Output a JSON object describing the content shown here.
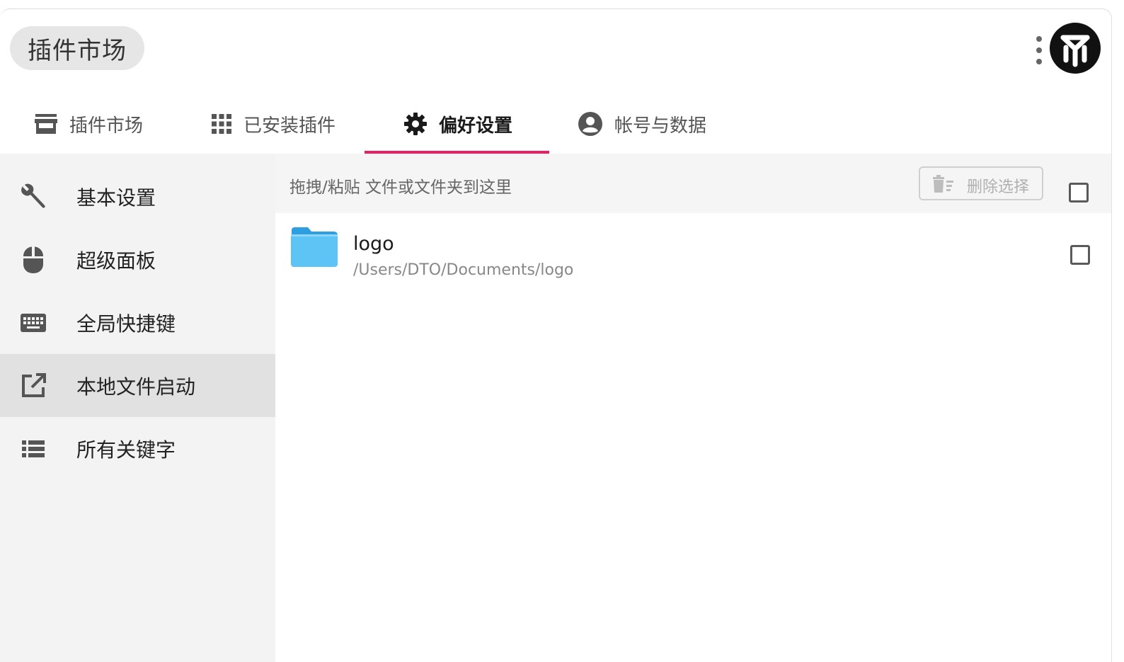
{
  "header": {
    "search_text": "插件市场"
  },
  "tabs": [
    {
      "label": "插件市场",
      "icon": "store-icon"
    },
    {
      "label": "已安装插件",
      "icon": "apps-grid-icon"
    },
    {
      "label": "偏好设置",
      "icon": "gear-icon",
      "active": true
    },
    {
      "label": "帐号与数据",
      "icon": "account-circle-icon"
    }
  ],
  "sidebar": {
    "items": [
      {
        "label": "基本设置",
        "icon": "wrench-icon"
      },
      {
        "label": "超级面板",
        "icon": "mouse-icon"
      },
      {
        "label": "全局快捷键",
        "icon": "keyboard-icon"
      },
      {
        "label": "本地文件启动",
        "icon": "open-in-new-icon",
        "active": true
      },
      {
        "label": "所有关键字",
        "icon": "list-icon"
      }
    ]
  },
  "main": {
    "drop_hint": "拖拽/粘贴 文件或文件夹到这里",
    "delete_label": "删除选择",
    "files": [
      {
        "name": "logo",
        "path": "/Users/DTO/Documents/logo",
        "icon": "folder-icon"
      }
    ]
  },
  "colors": {
    "accent": "#e91e63",
    "sidebar_bg": "#f3f3f3",
    "sidebar_active": "#e1e1e1",
    "folder": "#5ec3f5"
  }
}
